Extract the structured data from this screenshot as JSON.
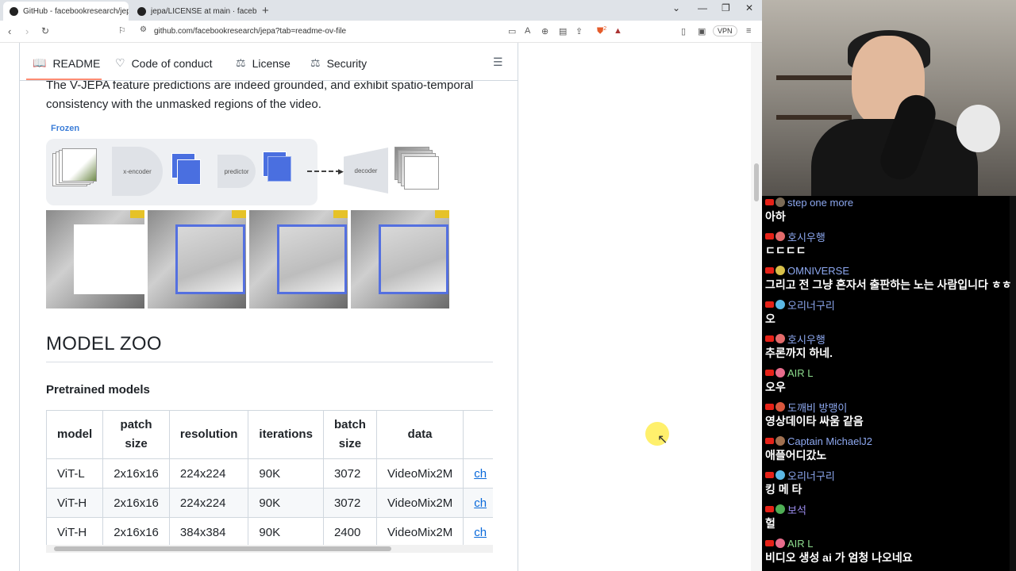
{
  "browser": {
    "tabs": [
      {
        "title": "GitHub - facebookresearch/jep",
        "active": true
      },
      {
        "title": "jepa/LICENSE at main · facebookre",
        "active": false
      }
    ],
    "new_tab": "+",
    "url": "github.com/facebookresearch/jepa?tab=readme-ov-file",
    "vpn": "VPN",
    "brave_badge": "2"
  },
  "readme_tabs": [
    {
      "label": "README",
      "icon": "book-icon"
    },
    {
      "label": "Code of conduct",
      "icon": "heart-icon"
    },
    {
      "label": "License",
      "icon": "law-icon"
    },
    {
      "label": "Security",
      "icon": "law-icon"
    }
  ],
  "content": {
    "paragraph": "The V-JEPA feature predictions are indeed grounded, and exhibit spatio-temporal consistency with the unmasked regions of the video.",
    "figure": {
      "frozen_label": "Frozen",
      "x_encoder": "x-encoder",
      "predictor": "predictor",
      "decoder": "decoder"
    },
    "section_title": "MODEL ZOO",
    "subsection_title": "Pretrained models",
    "table": {
      "headers": [
        "model",
        "patch size",
        "resolution",
        "iterations",
        "batch size",
        "data",
        ""
      ],
      "rows": [
        [
          "ViT-L",
          "2x16x16",
          "224x224",
          "90K",
          "3072",
          "VideoMix2M",
          "ch"
        ],
        [
          "ViT-H",
          "2x16x16",
          "224x224",
          "90K",
          "3072",
          "VideoMix2M",
          "ch"
        ],
        [
          "ViT-H",
          "2x16x16",
          "384x384",
          "90K",
          "2400",
          "VideoMix2M",
          "ch"
        ]
      ]
    }
  },
  "chat": [
    {
      "name": "step one more",
      "text": "아하",
      "name_color": "#8da8f0",
      "avatar": "#7b6a55"
    },
    {
      "name": "호시우행",
      "text": "ㄷㄷㄷㄷ",
      "name_color": "#8da8f0",
      "avatar": "#e36b6b"
    },
    {
      "name": "OMNIVERSE",
      "text": "그리고 전 그냥 혼자서 출판하는 노는 사람입니다 ㅎㅎ",
      "name_color": "#8da8f0",
      "avatar": "#d8c04a"
    },
    {
      "name": "오리너구리",
      "text": "오",
      "name_color": "#8da8f0",
      "avatar": "#5bb8e6"
    },
    {
      "name": "호시우행",
      "text": "추론까지 하네.",
      "name_color": "#8da8f0",
      "avatar": "#e36b6b"
    },
    {
      "name": "AIR L",
      "text": "오우",
      "name_color": "#8ddc8d",
      "avatar": "#e86d8c"
    },
    {
      "name": "도깨비 방맹이",
      "text": "영상데이타 싸움 같음",
      "name_color": "#8da8f0",
      "avatar": "#d9573e"
    },
    {
      "name": "Captain MichaelJ2",
      "text": "애플어디갔노",
      "name_color": "#8da8f0",
      "avatar": "#a07050"
    },
    {
      "name": "오리너구리",
      "text": "킹 메 타",
      "name_color": "#8da8f0",
      "avatar": "#5bb8e6"
    },
    {
      "name": "보석",
      "text": "헐",
      "name_color": "#9c8df0",
      "avatar": "#4fae55"
    },
    {
      "name": "AIR L",
      "text": "비디오 생성 ai 가 엄청 나오네요",
      "name_color": "#8ddc8d",
      "avatar": "#e86d8c"
    }
  ]
}
